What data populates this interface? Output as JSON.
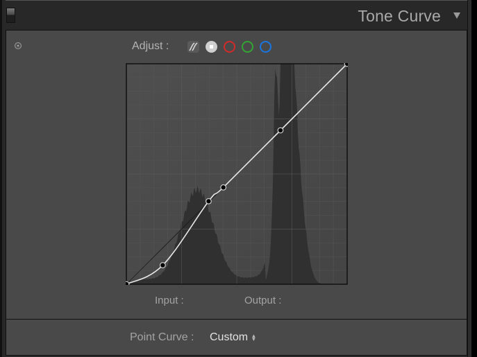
{
  "header": {
    "title": "Tone Curve",
    "panel_switch_icon": "panel-toggle-switch",
    "collapse_icon": "triangle-down"
  },
  "adjust": {
    "label": "Adjust :",
    "target_adjust_icon": "target-adjust",
    "channels": [
      {
        "name": "parametric",
        "icon": "parametric-curve-icon"
      },
      {
        "name": "rgb",
        "icon": "rgb-channel",
        "color": "#cfcfcf",
        "selected": true
      },
      {
        "name": "red",
        "icon": "red-channel",
        "color": "#d22a2a"
      },
      {
        "name": "green",
        "icon": "green-channel",
        "color": "#33a533"
      },
      {
        "name": "blue",
        "icon": "blue-channel",
        "color": "#1b74e0"
      }
    ]
  },
  "curve": {
    "channel": "RGB",
    "domain_max": 255,
    "points": [
      [
        0,
        0
      ],
      [
        42,
        22
      ],
      [
        95,
        96
      ],
      [
        112,
        112
      ],
      [
        178,
        178
      ],
      [
        255,
        255
      ]
    ],
    "curve_color": "#e8e8e8",
    "histogram_color": "#2e2e2e",
    "grid_divisions": 4,
    "grid_minor_divisions": 16
  },
  "readout": {
    "input_label": "Input :",
    "input_value": "",
    "output_label": "Output :",
    "output_value": ""
  },
  "point_curve": {
    "label": "Point Curve :",
    "value": "Custom"
  },
  "colors": {
    "panel_bg": "#494949",
    "header_bg": "#282828",
    "title_text": "#a9a9a9"
  }
}
